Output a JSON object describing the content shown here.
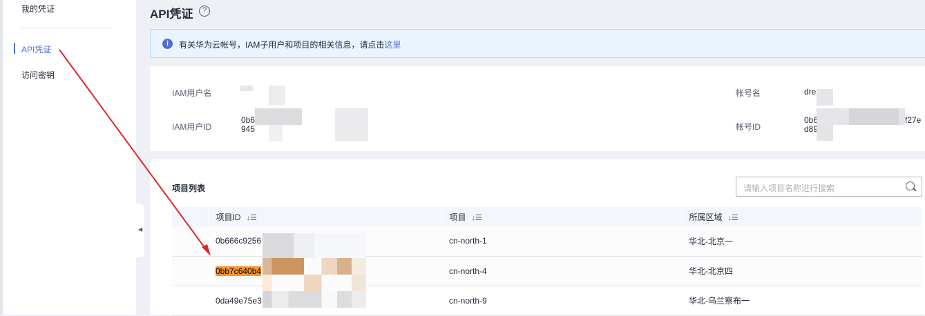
{
  "sidebar": {
    "section": "我的凭证",
    "items": [
      {
        "label": "API凭证",
        "active": true
      },
      {
        "label": "访问密钥"
      }
    ]
  },
  "header": {
    "title": "API凭证"
  },
  "info": {
    "text": "有关华为云帐号，IAM子用户和项目的相关信息，请点击",
    "link": "这里"
  },
  "user": {
    "iam_name_label": "IAM用户名",
    "iam_id_label": "IAM用户ID",
    "iam_id_line1": "0b6",
    "iam_id_line2": "945",
    "account_name_label": "帐号名",
    "account_name": "dre",
    "account_id_label": "帐号ID",
    "account_id_line1": "0b6",
    "account_id_suffix": "f27e",
    "account_id_line2": "d89"
  },
  "projects": {
    "title": "项目列表",
    "search_placeholder": "请输入项目名称进行搜索",
    "columns": [
      "项目ID",
      "项目",
      "所属区域"
    ],
    "rows": [
      {
        "id": "0b666c9256",
        "project": "cn-north-1",
        "region": "华北-北京一"
      },
      {
        "id": "0bb7c640b4",
        "project": "cn-north-4",
        "region": "华北-北京四",
        "highlighted": true
      },
      {
        "id": "0da49e75e3",
        "project": "cn-north-9",
        "region": "华北-乌兰察布一"
      }
    ]
  },
  "annotation_color": "#e0262a"
}
